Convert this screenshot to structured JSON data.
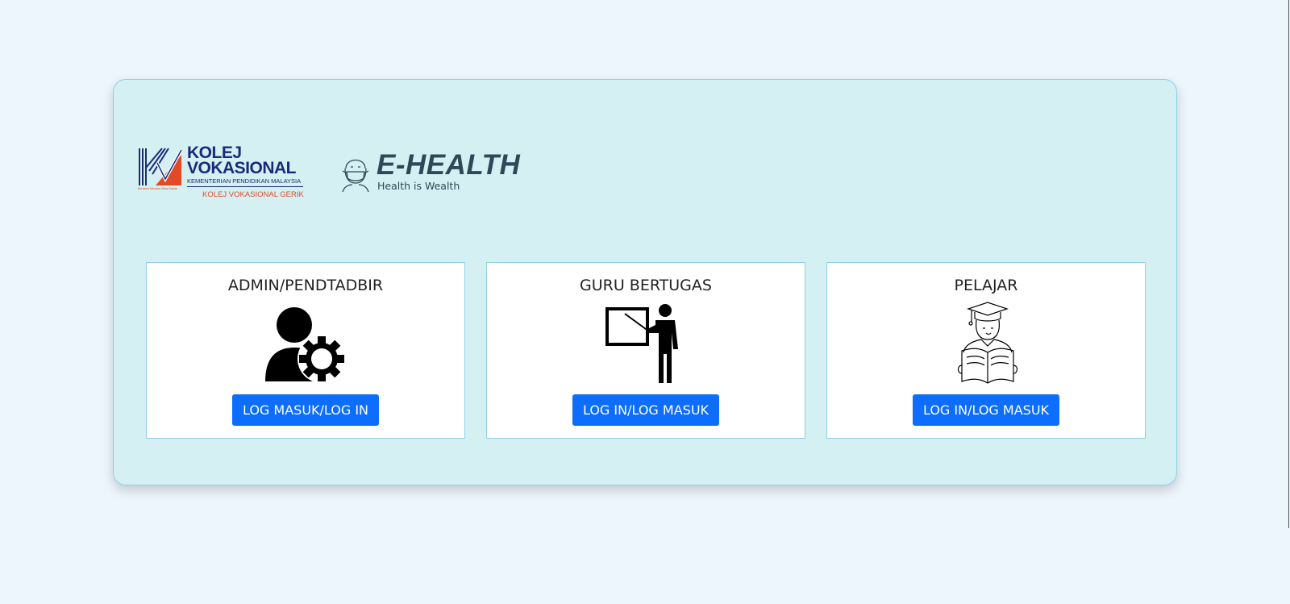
{
  "logos": {
    "kv_line1": "KOLEJ",
    "kv_line2": "VOKASIONAL",
    "kv_sub": "KEMENTERIAN PENDIDIKAN MALAYSIA",
    "kv_college": "KOLEJ VOKASIONAL GERIK",
    "kv_tagline": "Bersama Memacu Masa Depan",
    "eh_title": "E-HEALTH",
    "eh_tagline": "Health is Wealth"
  },
  "cards": [
    {
      "title": "ADMIN/PENDTADBIR",
      "button": "LOG MASUK/LOG IN",
      "icon": "admin-gear-icon"
    },
    {
      "title": "GURU BERTUGAS",
      "button": "LOG IN/LOG MASUK",
      "icon": "teacher-board-icon"
    },
    {
      "title": "PELAJAR",
      "button": "LOG IN/LOG MASUK",
      "icon": "student-reading-icon"
    }
  ],
  "colors": {
    "page_bg": "#edf5fd",
    "panel_bg": "#d4f0f3",
    "accent": "#0d6efd",
    "kv_navy": "#1b2a78",
    "kv_orange": "#e24a25",
    "eh_slate": "#2f4858"
  }
}
